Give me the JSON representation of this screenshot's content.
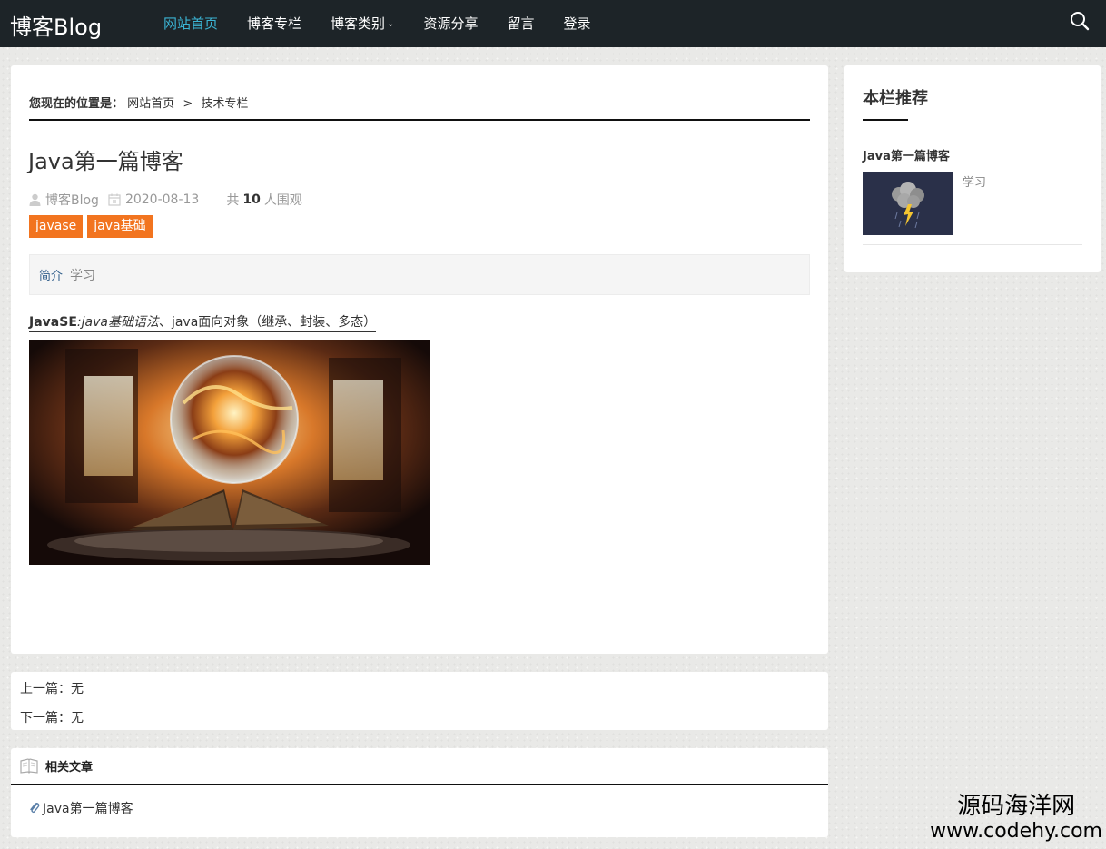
{
  "header": {
    "logo": "博客Blog",
    "nav": [
      {
        "label": "网站首页",
        "active": true
      },
      {
        "label": "博客专栏",
        "active": false
      },
      {
        "label": "博客类别",
        "active": false,
        "has_dropdown": true
      },
      {
        "label": "资源分享",
        "active": false
      },
      {
        "label": "留言",
        "active": false
      },
      {
        "label": "登录",
        "active": false
      }
    ],
    "dropdown_glyph": "⌄",
    "search_icon": "search-icon"
  },
  "breadcrumb": {
    "label": "您现在的位置是：",
    "home": "网站首页",
    "separator": ">",
    "current": "技术专栏"
  },
  "article": {
    "title": "Java第一篇博客",
    "author": "博客Blog",
    "date": "2020-08-13",
    "views_prefix": "共",
    "views_count": "10",
    "views_suffix": "人围观",
    "tags": [
      "javase",
      "java基础"
    ],
    "intro_label": "简介",
    "intro_text": "学习",
    "content_bold": "JavaSE",
    "content_italic": ":java基础语法",
    "content_rest": "、java面向对象（继承、封装、多态）",
    "image_alt": "magic-book-crystal-ball"
  },
  "pager": {
    "prev_label": "上一篇：",
    "prev_value": "无",
    "next_label": "下一篇：",
    "next_value": "无"
  },
  "related": {
    "title": "相关文章",
    "items": [
      "Java第一篇博客"
    ]
  },
  "sidebar": {
    "title": "本栏推荐",
    "post_title": "Java第一篇博客",
    "post_desc": "学习"
  },
  "watermark": {
    "line1": "源码海洋网",
    "line2": "www.codehy.com"
  },
  "colors": {
    "nav_bg": "#1d2428",
    "nav_active": "#3bb4d4",
    "tag_bg": "#f2741f"
  }
}
